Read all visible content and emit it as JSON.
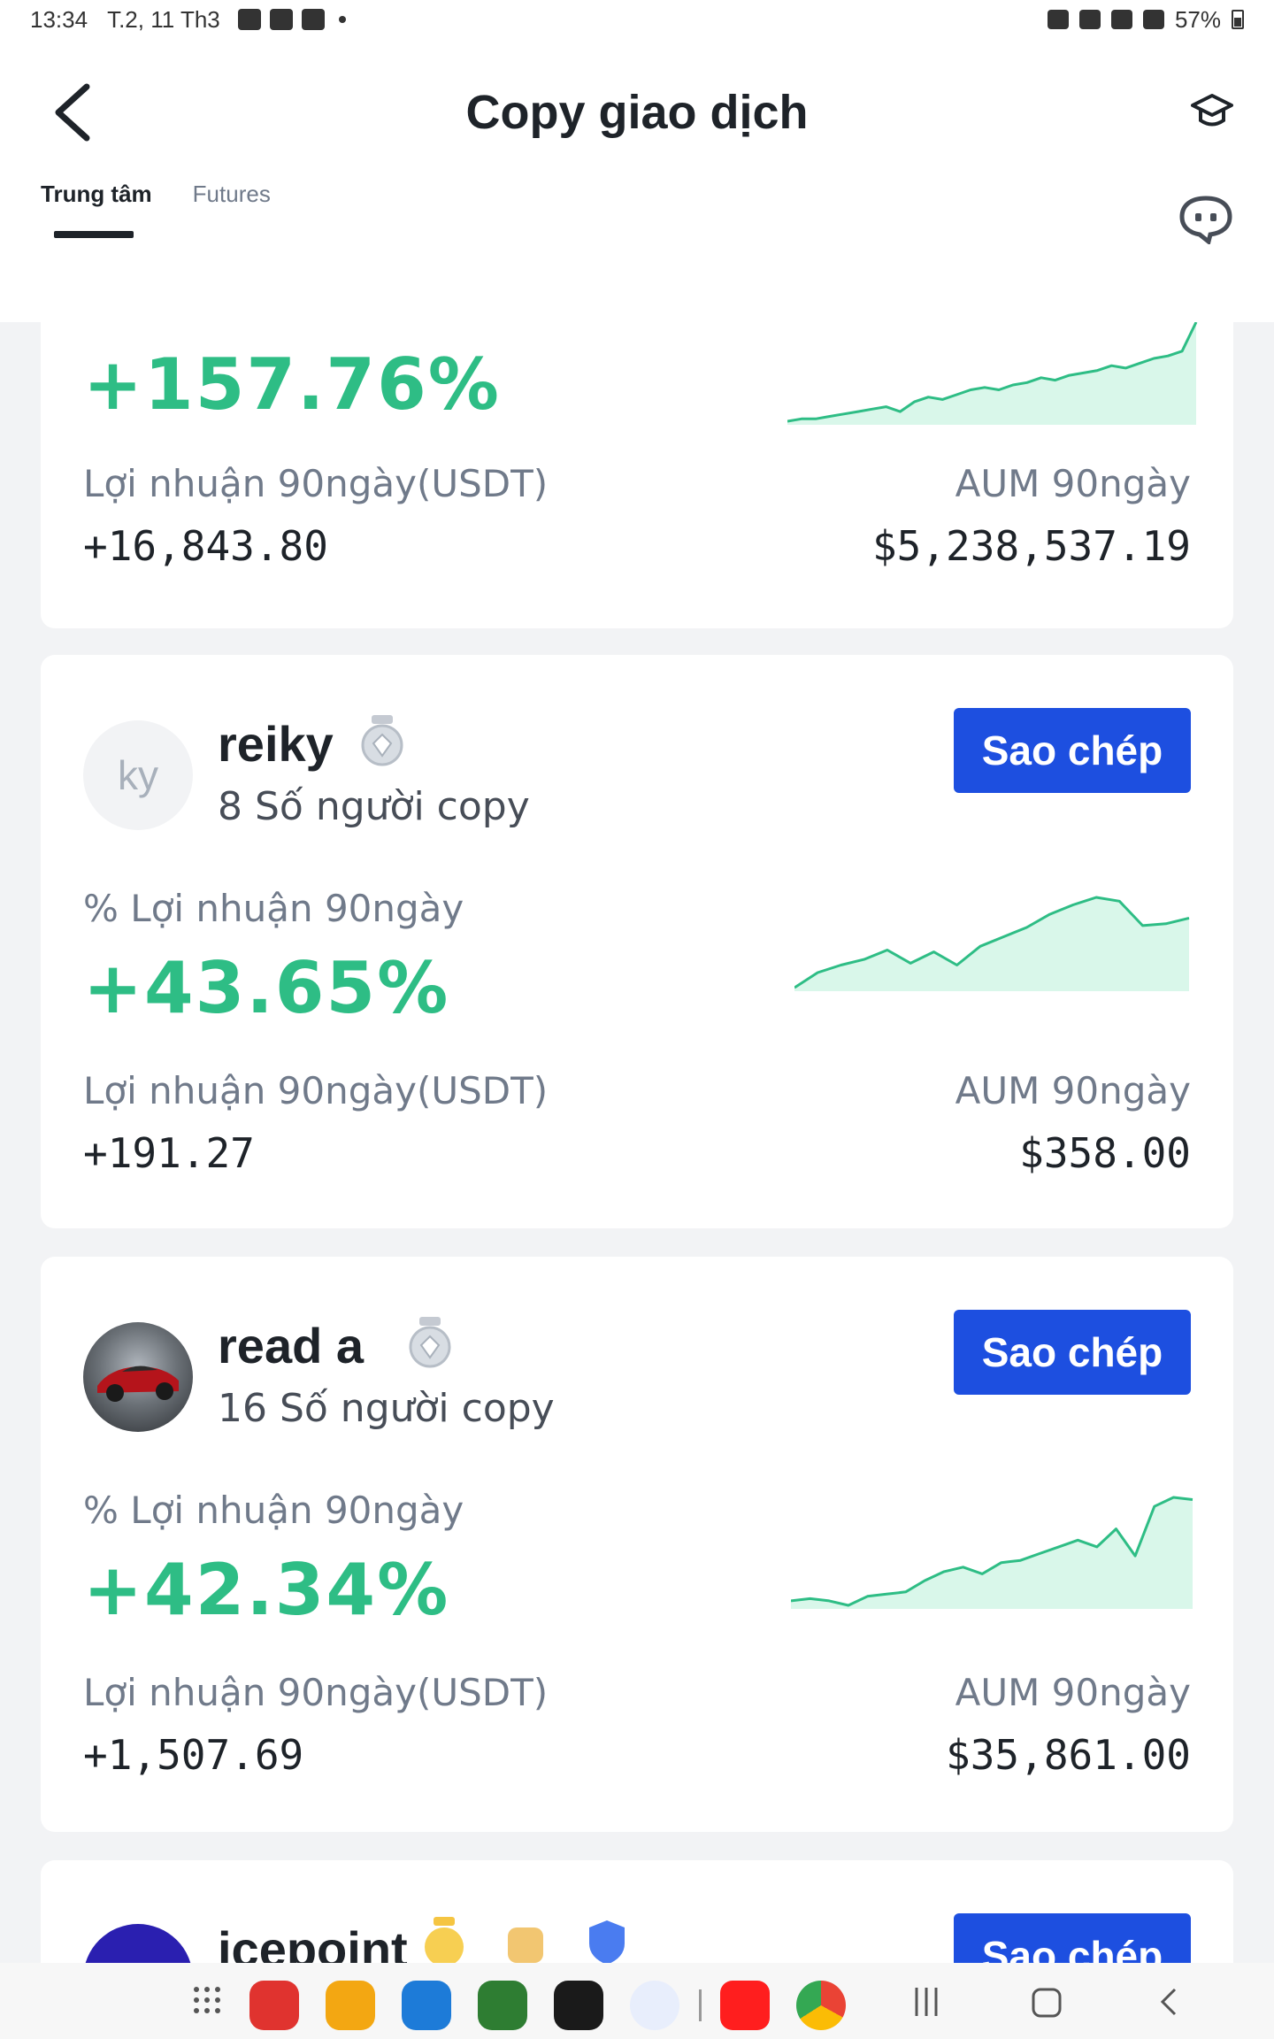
{
  "status_bar": {
    "time": "13:34",
    "date": "T.2, 11 Th3",
    "battery": "57%"
  },
  "header": {
    "title": "Copy giao dịch"
  },
  "tabs": [
    {
      "label": "Trung tâm"
    },
    {
      "label": "Futures"
    }
  ],
  "traders": [
    {
      "pnl_percent": "+157.76%",
      "pnl_usdt_label": "Lợi nhuận 90ngày(USDT)",
      "pnl_usdt": "+16,843.80",
      "aum_label": "AUM 90ngày",
      "aum": "$5,238,537.19",
      "sparkline": [
        1,
        2,
        2,
        3,
        4,
        5,
        6,
        7,
        5,
        9,
        11,
        10,
        12,
        14,
        15,
        14,
        16,
        17,
        19,
        18,
        20,
        21,
        22,
        24,
        23,
        25,
        27,
        28,
        30,
        42
      ]
    },
    {
      "name": "reiky",
      "avatar_text": "ky",
      "copiers": "8 Số người copy",
      "button": "Sao chép",
      "pnl_label": "% Lợi nhuận 90ngày",
      "pnl_percent": "+43.65%",
      "pnl_usdt_label": "Lợi nhuận 90ngày(USDT)",
      "pnl_usdt": "+191.27",
      "aum_label": "AUM 90ngày",
      "aum": "$358.00",
      "sparkline": [
        0,
        8,
        12,
        15,
        20,
        13,
        19,
        12,
        22,
        27,
        32,
        39,
        44,
        48,
        46,
        33,
        34,
        37
      ]
    },
    {
      "name": "read a",
      "copiers": "16 Số người copy",
      "button": "Sao chép",
      "pnl_label": "% Lợi nhuận 90ngày",
      "pnl_percent": "+42.34%",
      "pnl_usdt_label": "Lợi nhuận 90ngày(USDT)",
      "pnl_usdt": "+1,507.69",
      "aum_label": "AUM 90ngày",
      "aum": "$35,861.00",
      "sparkline": [
        0,
        1,
        0,
        -2,
        2,
        3,
        4,
        9,
        13,
        15,
        12,
        17,
        18,
        21,
        24,
        27,
        24,
        32,
        20,
        42,
        46,
        45
      ]
    },
    {
      "name": "icepoint",
      "button": "Sao chép"
    }
  ],
  "colors": {
    "profit": "#2ebd85",
    "button": "#1d4fe0",
    "chart_fill": "#d9f7ea"
  }
}
